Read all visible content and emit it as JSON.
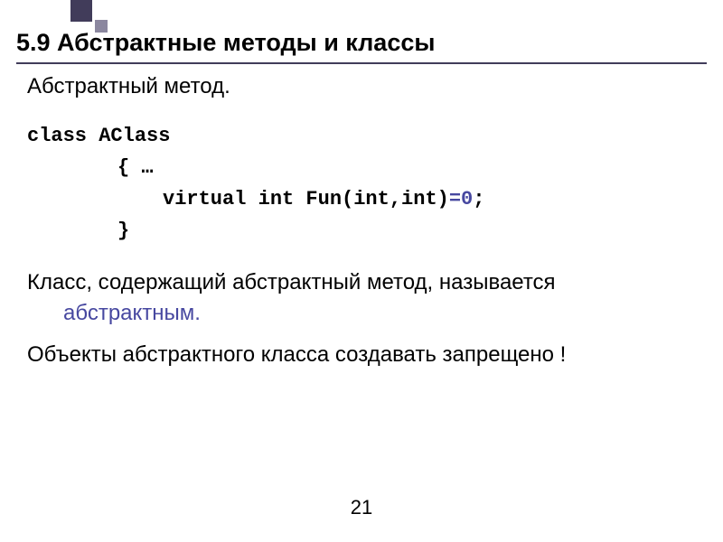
{
  "title": "5.9 Абстрактные методы и классы",
  "subtitle": "Абстрактный метод.",
  "code": {
    "line1": "class AClass",
    "line2": "{ …",
    "line3_part1": "virtual int Fun(int,int)",
    "line3_part2": "=0",
    "line3_part3": ";",
    "line4": "}"
  },
  "description": {
    "text1": "Класс, содержащий абстрактный метод, называется ",
    "highlighted": "абстрактным.",
    "text2": "Объекты абстрактного класса создавать запрещено !"
  },
  "page_number": "21"
}
